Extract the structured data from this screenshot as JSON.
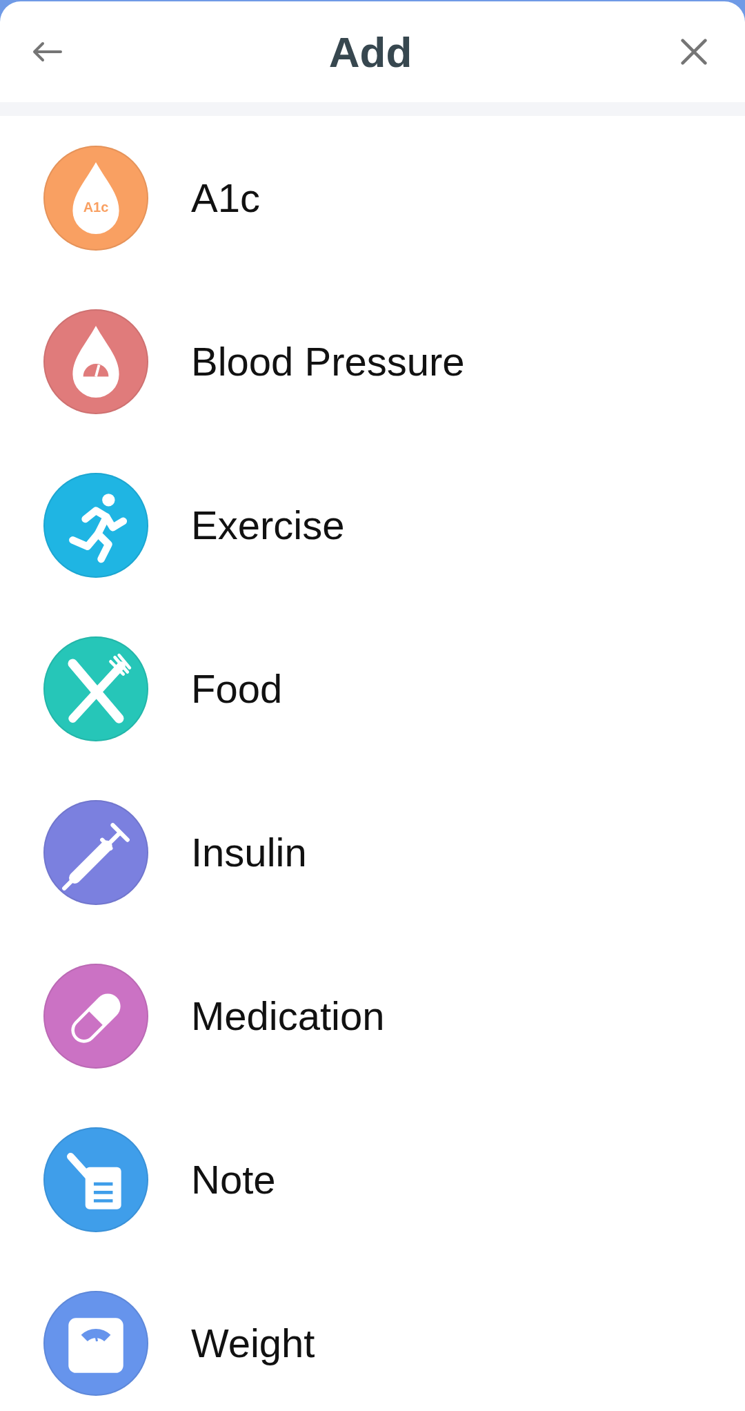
{
  "header": {
    "title": "Add"
  },
  "items": [
    {
      "label": "A1c",
      "kind": "a1c",
      "color": "#f9a062",
      "icon_text": "A1c"
    },
    {
      "label": "Blood Pressure",
      "kind": "blood-pressure",
      "color": "#e07b7b"
    },
    {
      "label": "Exercise",
      "kind": "exercise",
      "color": "#1fb5e3"
    },
    {
      "label": "Food",
      "kind": "food",
      "color": "#26c6b8"
    },
    {
      "label": "Insulin",
      "kind": "insulin",
      "color": "#7b80df"
    },
    {
      "label": "Medication",
      "kind": "medication",
      "color": "#cb72c4"
    },
    {
      "label": "Note",
      "kind": "note",
      "color": "#3f9eea"
    },
    {
      "label": "Weight",
      "kind": "weight",
      "color": "#6694ec"
    }
  ]
}
